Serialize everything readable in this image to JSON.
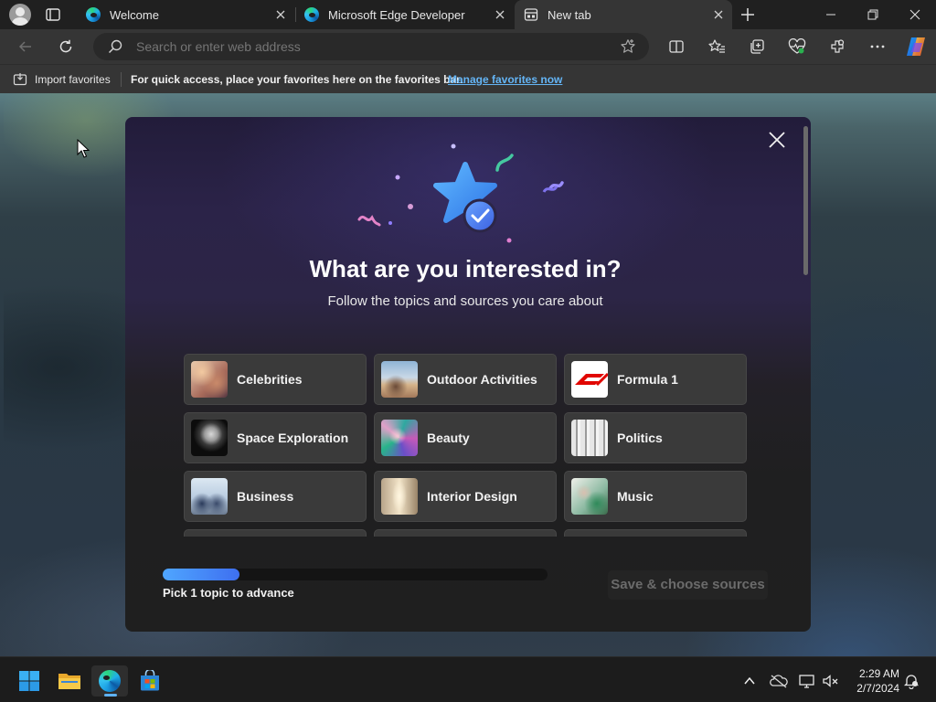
{
  "browser": {
    "tabs": [
      {
        "title": "Welcome",
        "icon": "edge-icon",
        "active": false
      },
      {
        "title": "Microsoft Edge Developer",
        "icon": "edge-icon",
        "active": false
      },
      {
        "title": "New tab",
        "icon": "new-tab-page-icon",
        "active": true
      }
    ],
    "address_placeholder": "Search or enter web address",
    "favorites_bar": {
      "import_label": "Import favorites",
      "message": "For quick access, place your favorites here on the favorites bar.",
      "link": "Manage favorites now"
    }
  },
  "dialog": {
    "title": "What are you interested in?",
    "subtitle": "Follow the topics and sources you care about",
    "topics": [
      {
        "label": "Celebrities"
      },
      {
        "label": "Outdoor Activities"
      },
      {
        "label": "Formula 1"
      },
      {
        "label": "Space Exploration"
      },
      {
        "label": "Beauty"
      },
      {
        "label": "Politics"
      },
      {
        "label": "Business"
      },
      {
        "label": "Interior Design"
      },
      {
        "label": "Music"
      }
    ],
    "progress_fraction": 0.2,
    "progress_text": "Pick 1 topic to advance",
    "save_button": "Save & choose sources",
    "accent_color": "#4fa6ff"
  },
  "taskbar": {
    "time": "2:29 AM",
    "date": "2/7/2024",
    "apps": [
      "start-icon",
      "file-explorer-icon",
      "edge-icon",
      "store-icon"
    ]
  }
}
